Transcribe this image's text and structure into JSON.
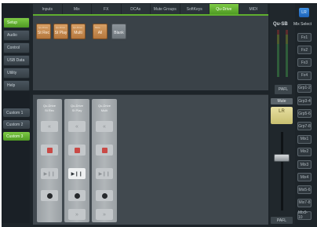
{
  "menu": {
    "items": [
      "Setup",
      "Audio",
      "Control",
      "USB Data",
      "Utility",
      "Help"
    ],
    "active_index": 0
  },
  "custom": {
    "items": [
      "Custom 1",
      "Custom 2",
      "Custom 3"
    ],
    "active_index": 2
  },
  "tabs": {
    "items": [
      "Inputs",
      "Mix",
      "FX",
      "DCAs",
      "Mute Groups",
      "SoftKeys",
      "Qu-Drive",
      "MIDI"
    ],
    "active_index": 6
  },
  "softkeys": {
    "keys": [
      {
        "sub": "Qu-Drive",
        "label": "St Rec"
      },
      {
        "sub": "Qu-Drive",
        "label": "St Play"
      },
      {
        "sub": "Qu-Drive",
        "label": "Multi"
      },
      {
        "sub": "Mute",
        "label": "All"
      },
      {
        "sub": "",
        "label": "Blank"
      }
    ]
  },
  "strips": [
    {
      "title_line1": "Qu-Drive",
      "title_line2": "St Rec"
    },
    {
      "title_line1": "Qu-Drive",
      "title_line2": "St Play"
    },
    {
      "title_line1": "Qu-Drive",
      "title_line2": "Multi"
    }
  ],
  "master": {
    "model": "Qu-SB",
    "pafl": "PAFL",
    "mute": "Mute",
    "lr": "LR",
    "pafl2": "PAFL"
  },
  "mix_select": {
    "title": "Mix Select",
    "top": "LR",
    "items": [
      "Fx1",
      "Fx2",
      "Fx3",
      "Fx4",
      "Grp1-2",
      "Grp3-4",
      "Grp5-6",
      "Grp7-8",
      "Mix1",
      "Mix2",
      "Mix3",
      "Mix4",
      "Mix5-6",
      "Mix7-8",
      "Mix9-10"
    ]
  },
  "colors": {
    "accent_green": "#6cbf3a",
    "softkey_orange": "#c88a4e",
    "mix_blue": "#2a7bd1",
    "lr_yellow": "#dcd38d"
  },
  "icons": {
    "rewind": "double-chevron-up",
    "stop": "red-square",
    "play_pause": "play-pause",
    "record": "black-dot",
    "forward": "double-chevron-down"
  }
}
